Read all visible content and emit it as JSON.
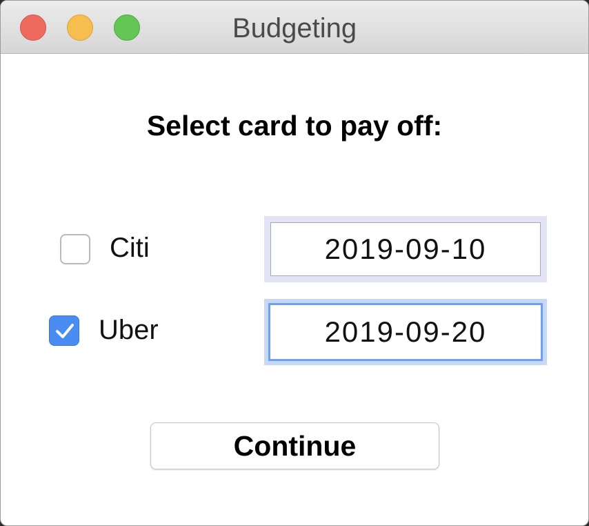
{
  "window": {
    "title": "Budgeting"
  },
  "traffic_lights": {
    "close_color": "#ee6a5f",
    "minimize_color": "#f5be4f",
    "zoom_color": "#62c554"
  },
  "dialog": {
    "heading": "Select card to pay off:",
    "cards": [
      {
        "label": "Citi",
        "checked": false,
        "date": "2019-09-10",
        "focused": false
      },
      {
        "label": "Uber",
        "checked": true,
        "date": "2019-09-20",
        "focused": true
      }
    ],
    "continue_label": "Continue"
  },
  "colors": {
    "accent": "#4a8cf2",
    "focus_ring": "#6fa0ee"
  },
  "icons": {
    "checkmark": "check-icon"
  }
}
